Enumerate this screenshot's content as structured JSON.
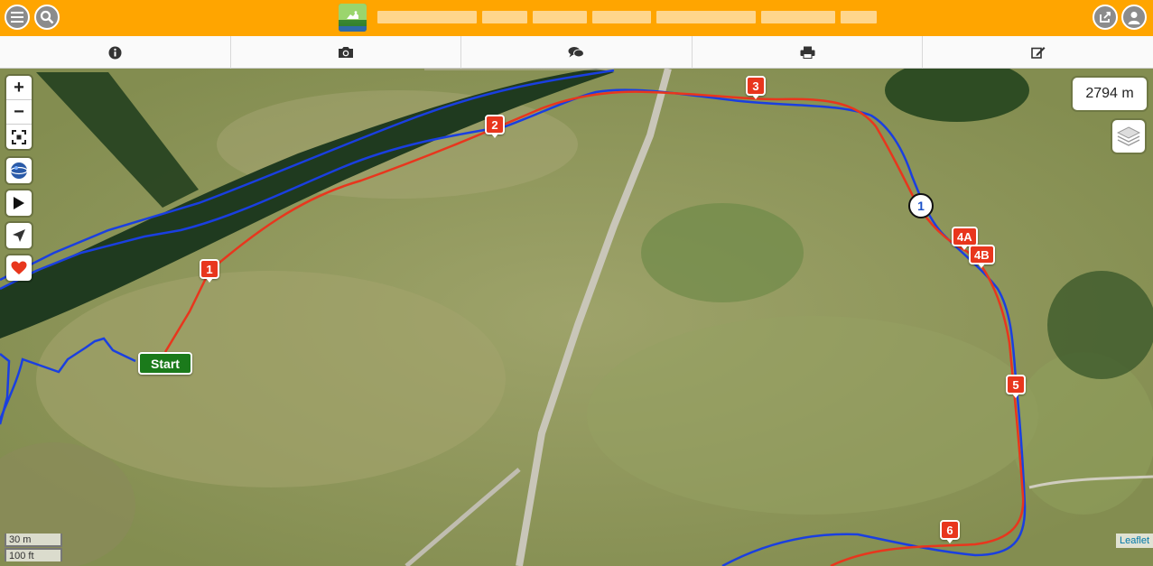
{
  "header": {
    "menu_icon": "menu-icon",
    "search_icon": "search-icon",
    "share_icon": "share-icon",
    "user_icon": "user-icon",
    "logo_icon": "app-logo-icon"
  },
  "tabs": [
    {
      "icon": "info-icon"
    },
    {
      "icon": "camera-icon"
    },
    {
      "icon": "comments-icon"
    },
    {
      "icon": "print-icon"
    },
    {
      "icon": "edit-icon"
    }
  ],
  "map": {
    "distance": "2794 m",
    "start_label": "Start",
    "waypoint_1": "1",
    "waypoint_2": "2",
    "waypoint_3": "3",
    "waypoint_4a": "4A",
    "waypoint_4b": "4B",
    "waypoint_5": "5",
    "waypoint_6": "6",
    "circle_label": "1",
    "scale_metric": "30 m",
    "scale_imperial": "100 ft",
    "attribution": "Leaflet",
    "zoom_in": "+",
    "zoom_out": "−"
  },
  "colors": {
    "header_bg": "#ffa500",
    "route_red": "#e8361d",
    "route_blue": "#1a3fe0",
    "start_green": "#1b7a1b"
  }
}
